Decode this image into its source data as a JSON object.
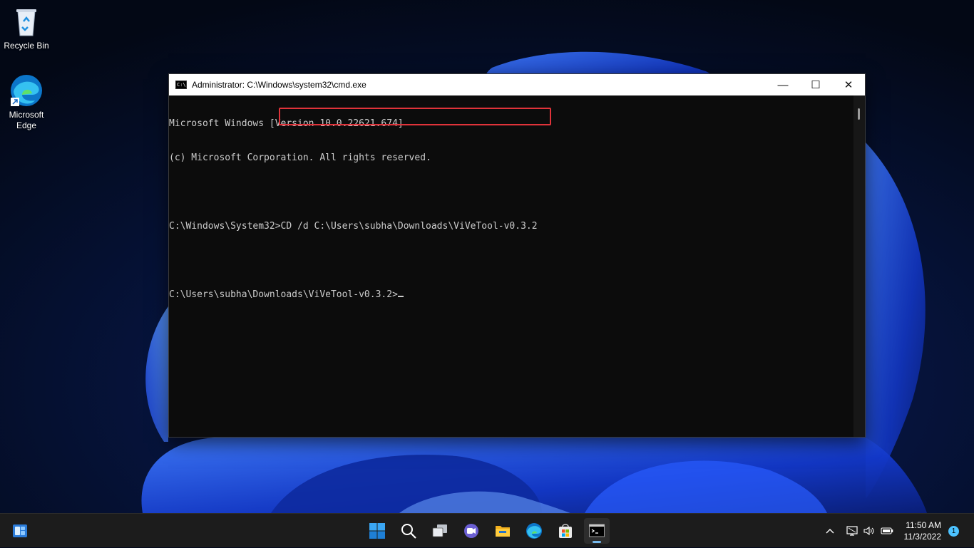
{
  "desktop": {
    "icons": [
      {
        "label": "Recycle Bin",
        "icon": "recycle-bin-icon"
      },
      {
        "label": "Microsoft Edge",
        "icon": "edge-icon"
      }
    ]
  },
  "cmd_window": {
    "title": "Administrator: C:\\Windows\\system32\\cmd.exe",
    "icon_text": "C:\\",
    "controls": {
      "minimize": "—",
      "maximize": "☐",
      "close": "✕"
    },
    "lines": [
      "Microsoft Windows [Version 10.0.22621.674]",
      "(c) Microsoft Corporation. All rights reserved.",
      "",
      "C:\\Windows\\System32>CD /d C:\\Users\\subha\\Downloads\\ViVeTool-v0.3.2",
      "",
      "C:\\Users\\subha\\Downloads\\ViVeTool-v0.3.2>"
    ],
    "highlight_color": "#e0333a"
  },
  "taskbar": {
    "apps": [
      {
        "name": "start",
        "icon": "windows-start-icon"
      },
      {
        "name": "search",
        "icon": "search-icon"
      },
      {
        "name": "task-view",
        "icon": "task-view-icon"
      },
      {
        "name": "chat",
        "icon": "teams-chat-icon"
      },
      {
        "name": "file-explorer",
        "icon": "folder-icon"
      },
      {
        "name": "edge",
        "icon": "edge-icon"
      },
      {
        "name": "store",
        "icon": "store-icon"
      },
      {
        "name": "terminal",
        "icon": "terminal-icon",
        "active": true
      }
    ],
    "tray_icons": [
      "chevron-up-icon",
      "network-icon",
      "volume-icon",
      "battery-icon"
    ],
    "time": "11:50 AM",
    "date": "11/3/2022",
    "notification_count": "1"
  },
  "colors": {
    "accent": "#76b9ed",
    "console_text": "#cccccc",
    "console_bg": "#0c0c0c"
  }
}
